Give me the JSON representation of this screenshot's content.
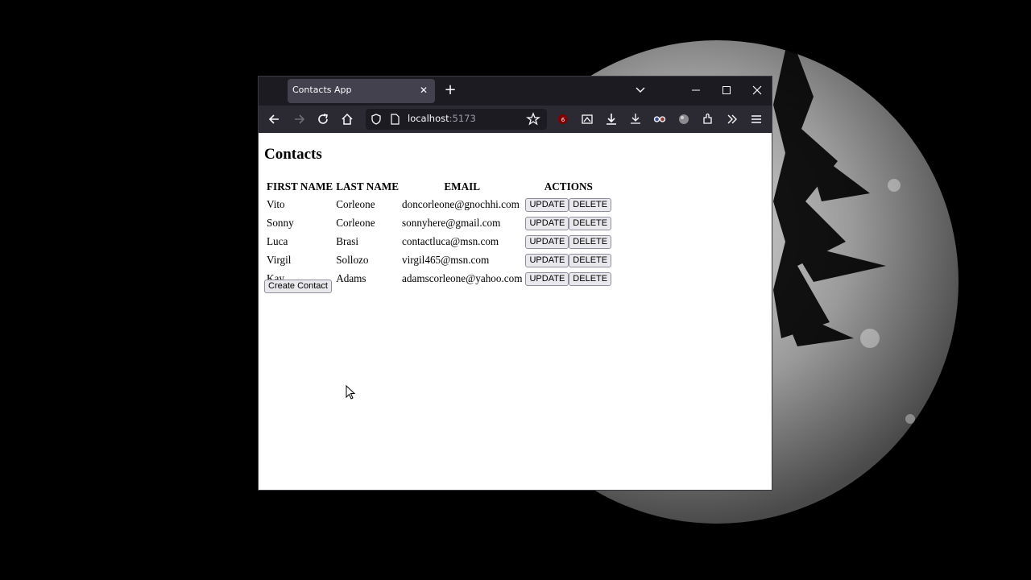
{
  "browser": {
    "tab_title": "Contacts App",
    "url_host": "localhost",
    "url_port": ":5173"
  },
  "page": {
    "heading": "Contacts",
    "columns": [
      "FIRST NAME",
      "LAST NAME",
      "EMAIL",
      "ACTIONS"
    ],
    "rows": [
      {
        "first": "Vito",
        "last": "Corleone",
        "email": "doncorleone@gnochhi.com"
      },
      {
        "first": "Sonny",
        "last": "Corleone",
        "email": "sonnyhere@gmail.com"
      },
      {
        "first": "Luca",
        "last": "Brasi",
        "email": "contactluca@msn.com"
      },
      {
        "first": "Virgil",
        "last": "Sollozo",
        "email": "virgil465@msn.com"
      },
      {
        "first": "Kay",
        "last": "Adams",
        "email": "adamscorleone@yahoo.com"
      }
    ],
    "update_label": "UPDATE",
    "delete_label": "DELETE",
    "create_label": "Create Contact"
  },
  "colors": {
    "tabbar_bg": "#1c1b22",
    "toolbar_bg": "#2b2a33",
    "active_tab_bg": "#42414d"
  },
  "icons": [
    "back-icon",
    "forward-icon",
    "reload-icon",
    "home-icon",
    "shield-icon",
    "page-icon",
    "star-icon",
    "extension-icon",
    "download-icon",
    "overflow-icon",
    "menu-icon",
    "close-icon",
    "plus-icon",
    "chevron-down-icon"
  ]
}
